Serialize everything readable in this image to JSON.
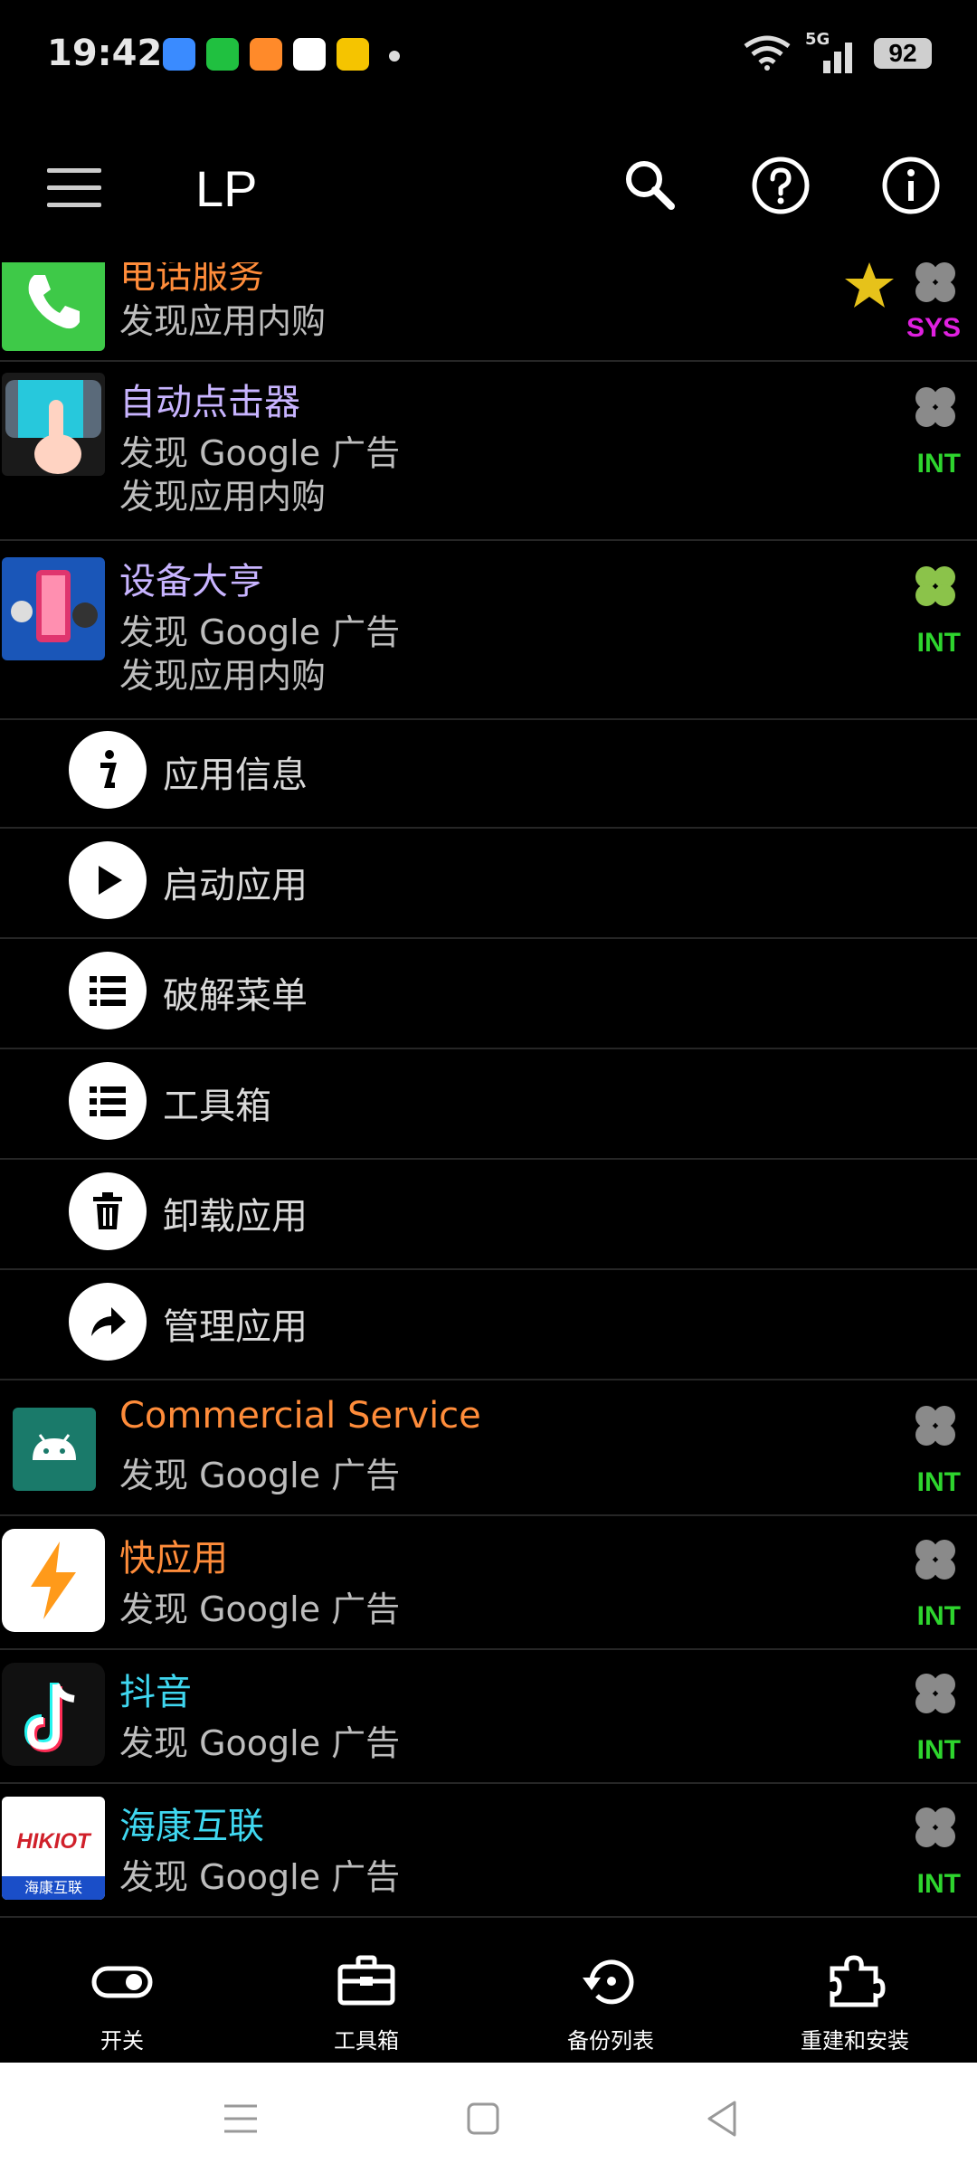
{
  "status_bar": {
    "time": "19:42",
    "battery": "92",
    "network": "5G"
  },
  "app_bar": {
    "title": "LP"
  },
  "apps_top": [
    {
      "name": "电话服务",
      "lines": [
        "发现应用内购"
      ],
      "name_color": "#ff8c3a",
      "badge": "SYS",
      "badge_color": "#e020e0",
      "clover": "gray",
      "favorite": true
    },
    {
      "name": "自动点击器",
      "lines": [
        "发现 Google 广告",
        "发现应用内购"
      ],
      "name_color": "#c8b4ff",
      "badge": "INT",
      "badge_color": "#2ed52e",
      "clover": "gray"
    },
    {
      "name": "设备大亨",
      "lines": [
        "发现 Google 广告",
        "发现应用内购"
      ],
      "name_color": "#c8b4ff",
      "badge": "INT",
      "badge_color": "#2ed52e",
      "clover": "green"
    }
  ],
  "context_menu": [
    {
      "label": "应用信息",
      "icon": "info-icon"
    },
    {
      "label": "启动应用",
      "icon": "play-icon"
    },
    {
      "label": "破解菜单",
      "icon": "list-icon"
    },
    {
      "label": "工具箱",
      "icon": "list-icon"
    },
    {
      "label": "卸载应用",
      "icon": "trash-icon"
    },
    {
      "label": "管理应用",
      "icon": "share-arrow-icon"
    }
  ],
  "apps_bottom": [
    {
      "name": "Commercial Service",
      "lines": [
        "发现 Google 广告"
      ],
      "name_color": "#ff8c3a",
      "badge": "INT",
      "badge_color": "#2ed52e"
    },
    {
      "name": "快应用",
      "lines": [
        "发现 Google 广告"
      ],
      "name_color": "#ff8c3a",
      "badge": "INT",
      "badge_color": "#2ed52e"
    },
    {
      "name": "抖音",
      "lines": [
        "发现 Google 广告"
      ],
      "name_color": "#3fd7f0",
      "badge": "INT",
      "badge_color": "#2ed52e"
    },
    {
      "name": "海康互联",
      "lines": [
        "发现 Google 广告"
      ],
      "name_color": "#3fd7f0",
      "badge": "INT",
      "badge_color": "#2ed52e",
      "icon_text": "HIKIOT",
      "icon_subtext": "海康互联"
    }
  ],
  "bottom_nav": [
    {
      "label": "开关",
      "icon": "toggle-icon"
    },
    {
      "label": "工具箱",
      "icon": "toolbox-icon"
    },
    {
      "label": "备份列表",
      "icon": "backup-restore-icon"
    },
    {
      "label": "重建和安装",
      "icon": "puzzle-icon"
    }
  ]
}
